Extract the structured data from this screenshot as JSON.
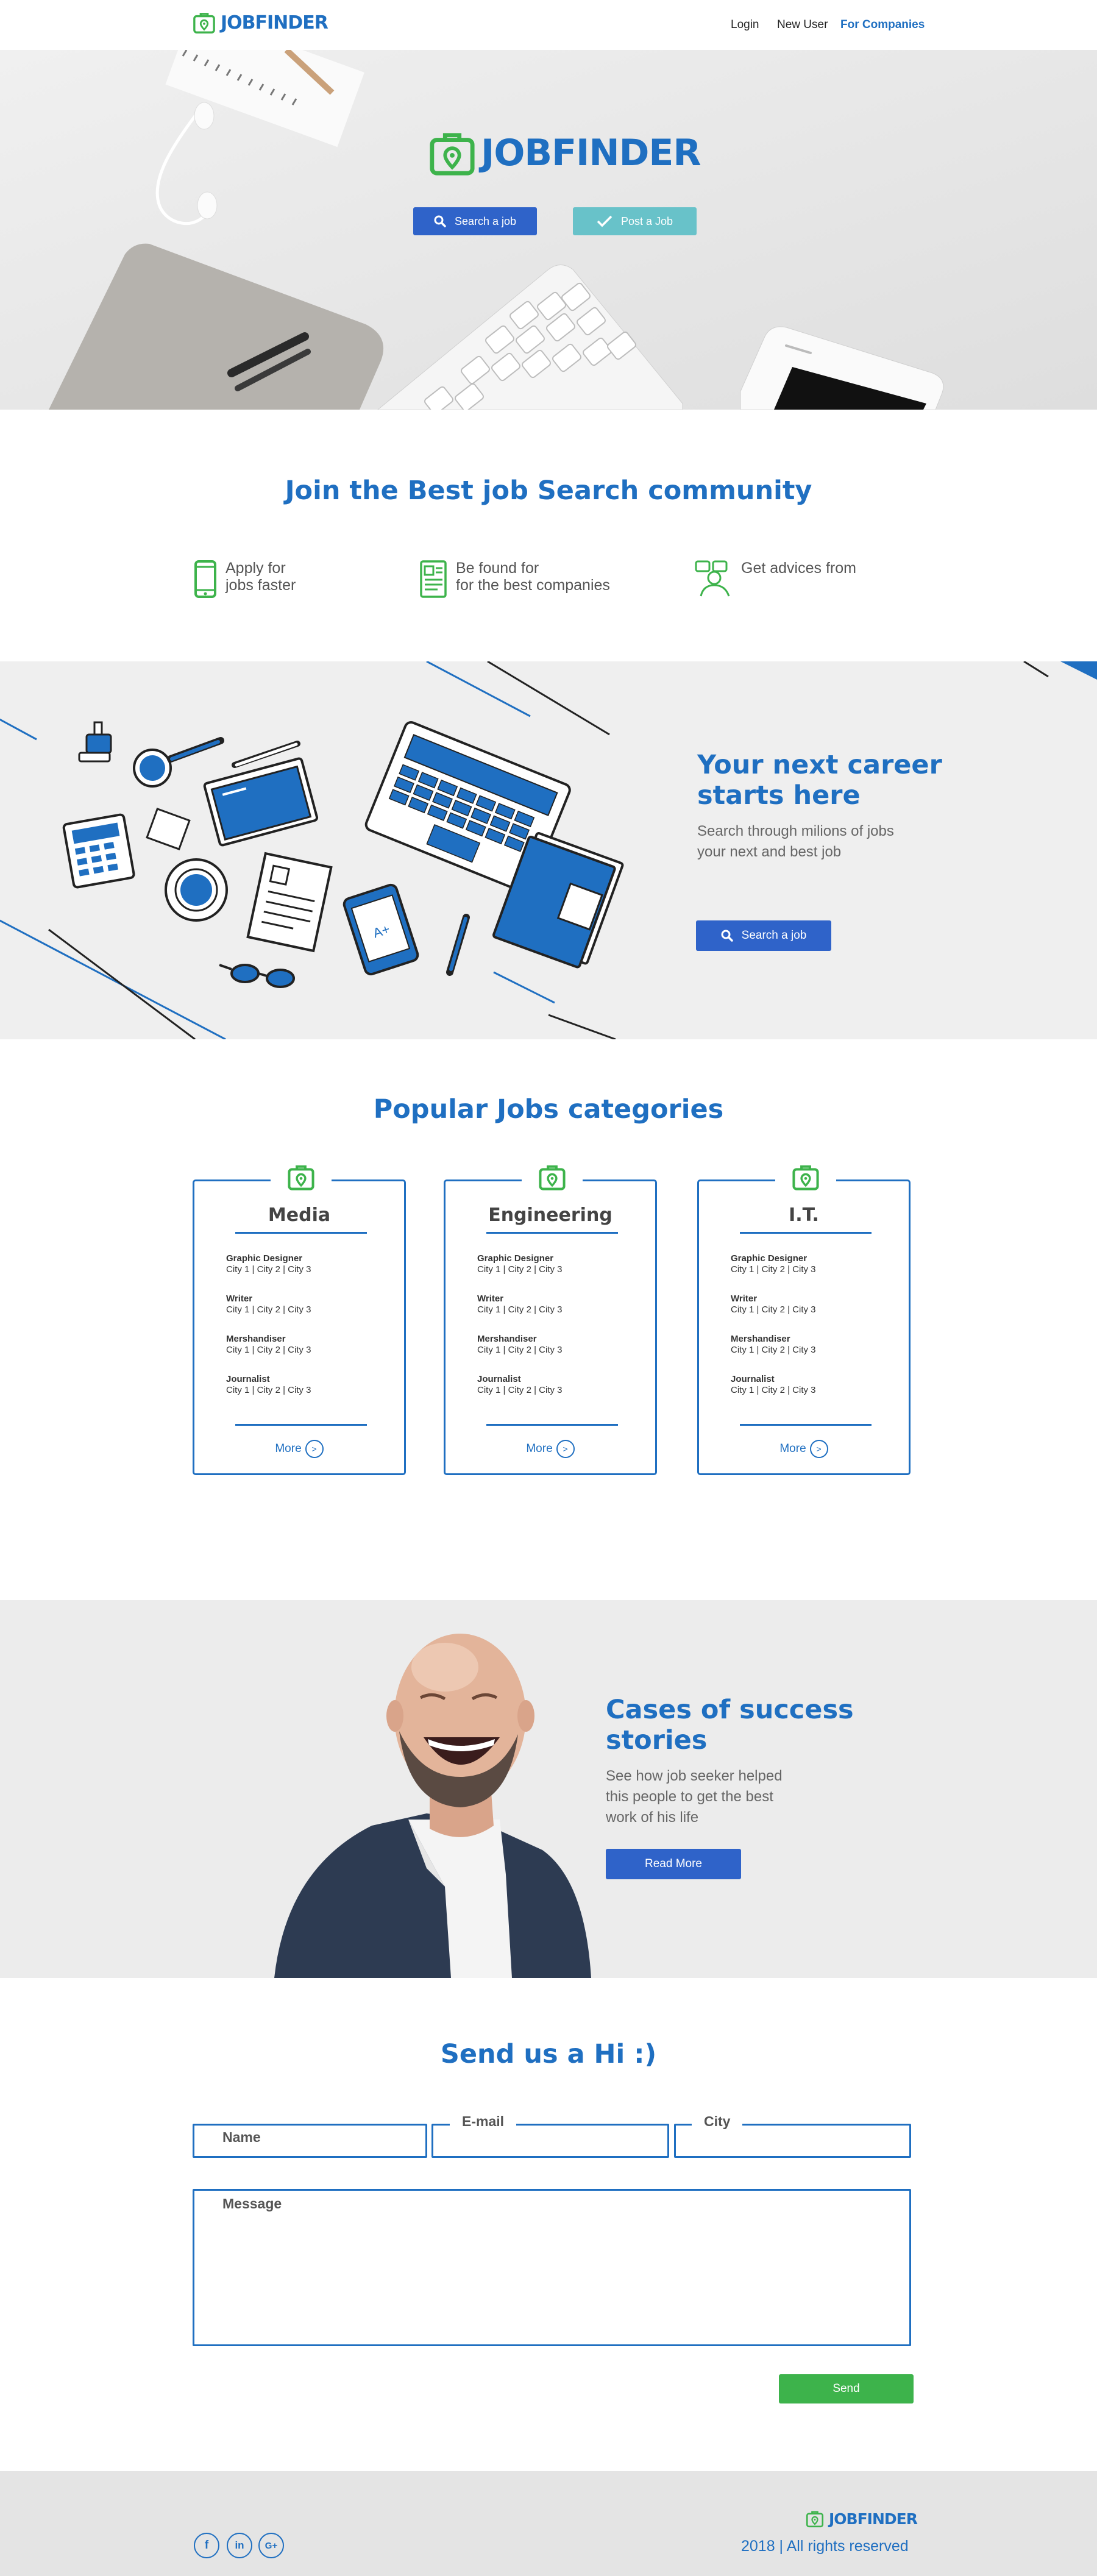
{
  "brand": {
    "name": "JOBFINDER"
  },
  "nav": {
    "login": "Login",
    "new_user": "New User",
    "for_companies": "For Companies"
  },
  "hero": {
    "search_button": "Search a job",
    "post_button": "Post a Job"
  },
  "community": {
    "title": "Join the Best job Search community",
    "features": [
      {
        "line1": "Apply for",
        "line2": "jobs faster"
      },
      {
        "line1": "Be found for",
        "line2": "for the best companies"
      },
      {
        "line1": "Get advices from",
        "line2": ""
      }
    ]
  },
  "career": {
    "title_line1": "Your next career",
    "title_line2": "starts here",
    "text_line1": "Search through milions of jobs",
    "text_line2": "your next and best job",
    "button": "Search a job",
    "phone_label": "A+"
  },
  "categories": {
    "title": "Popular Jobs categories",
    "more_label": "More",
    "cards": [
      {
        "title": "Media",
        "jobs": [
          {
            "name": "Graphic Designer",
            "cities": "City 1 | City 2 | City 3"
          },
          {
            "name": "Writer",
            "cities": "City 1 | City 2 | City 3"
          },
          {
            "name": "Mershandiser",
            "cities": "City 1 | City 2 | City 3"
          },
          {
            "name": "Journalist",
            "cities": "City 1 | City 2 | City 3"
          }
        ]
      },
      {
        "title": "Engineering",
        "jobs": [
          {
            "name": "Graphic Designer",
            "cities": "City 1 | City 2 | City 3"
          },
          {
            "name": "Writer",
            "cities": "City 1 | City 2 | City 3"
          },
          {
            "name": "Mershandiser",
            "cities": "City 1 | City 2 | City 3"
          },
          {
            "name": "Journalist",
            "cities": "City 1 | City 2 | City 3"
          }
        ]
      },
      {
        "title": "I.T.",
        "jobs": [
          {
            "name": "Graphic Designer",
            "cities": "City 1 | City 2 | City 3"
          },
          {
            "name": "Writer",
            "cities": "City 1 | City 2 | City 3"
          },
          {
            "name": "Mershandiser",
            "cities": "City 1 | City 2 | City 3"
          },
          {
            "name": "Journalist",
            "cities": "City 1 | City 2 | City 3"
          }
        ]
      }
    ]
  },
  "success": {
    "title_line1": "Cases of success",
    "title_line2": "stories",
    "text_line1": "See how job seeker helped",
    "text_line2": "this people to get the best",
    "text_line3": "work of his life",
    "button": "Read More"
  },
  "contact": {
    "title": "Send us a Hi :)",
    "name_label": "Name",
    "email_label": "E-mail",
    "city_label": "City",
    "message_label": "Message",
    "send_button": "Send"
  },
  "footer": {
    "copyright": "2018 | All rights reserved",
    "social": [
      "f",
      "in",
      "G+"
    ]
  },
  "colors": {
    "primary": "#1f6fc1",
    "button_blue": "#2f63c9",
    "teal": "#68c2c9",
    "green": "#3db34b"
  },
  "icons": [
    "briefcase-pin-icon",
    "search-icon",
    "check-icon",
    "phone-icon",
    "document-icon",
    "advice-person-icon",
    "arrow-right-icon",
    "facebook-icon",
    "linkedin-icon",
    "google-plus-icon"
  ]
}
